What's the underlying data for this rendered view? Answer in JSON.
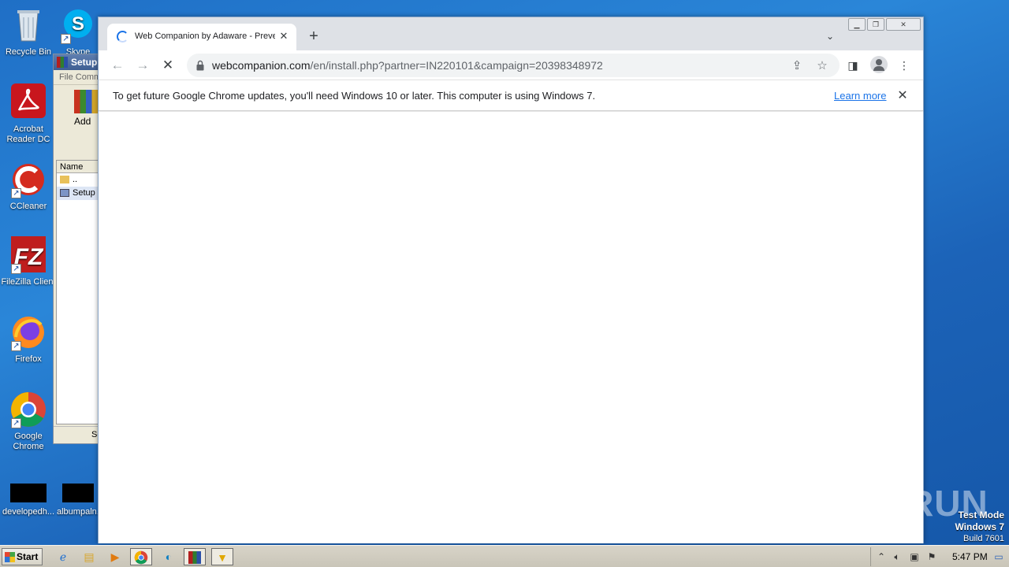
{
  "desktop": {
    "icons": [
      {
        "label": "Recycle Bin",
        "icon": "recycle-bin-icon"
      },
      {
        "label": "Skype",
        "icon": "skype-icon"
      },
      {
        "label": "Acrobat Reader DC",
        "icon": "acrobat-icon"
      },
      {
        "label": "CCleaner",
        "icon": "ccleaner-icon"
      },
      {
        "label": "FileZilla Client",
        "icon": "filezilla-icon"
      },
      {
        "label": "Firefox",
        "icon": "firefox-icon"
      },
      {
        "label": "Google Chrome",
        "icon": "chrome-icon"
      },
      {
        "label": "developedh...",
        "icon": "file-icon"
      },
      {
        "label": "albumpaln...",
        "icon": "file-icon"
      }
    ]
  },
  "winrar": {
    "title": "Setup",
    "menu": "File  Comm",
    "toolbar_add": "Add",
    "list_header": "Name",
    "rows": [
      "..",
      "Setup"
    ],
    "status": "Se"
  },
  "chrome": {
    "tab_title": "Web Companion by Adaware - Preve",
    "url_domain": "webcompanion.com",
    "url_path": "/en/install.php?partner=IN220101&campaign=20398348972",
    "infobar_message": "To get future Google Chrome updates, you'll need Windows 10 or later. This computer is using Windows 7.",
    "infobar_link": "Learn more"
  },
  "watermark": "ANY RUN",
  "system": {
    "test_mode": "Test Mode",
    "os": "Windows 7",
    "build": "Build 7601",
    "start_label": "Start",
    "clock": "5:47 PM"
  }
}
